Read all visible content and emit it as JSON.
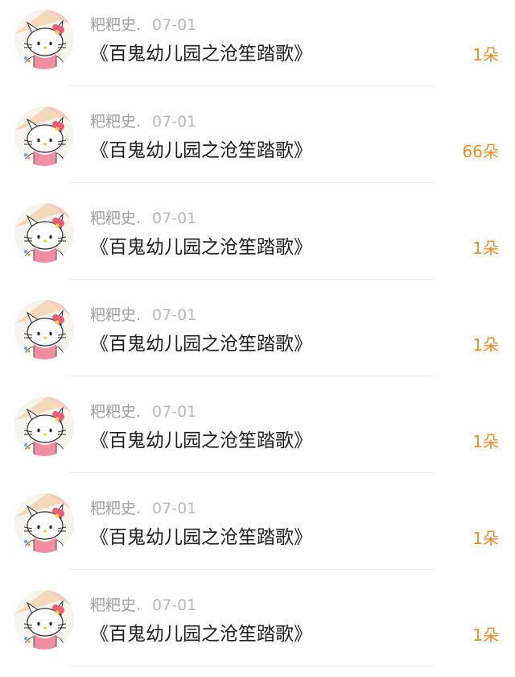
{
  "colors": {
    "count_accent": "#f08a2a",
    "meta_text": "#a0a0a0",
    "title_text": "#1f1f1f",
    "divider": "#efefef"
  },
  "avatar_icon": "hello-kitty-avatar",
  "items": [
    {
      "name": "粑粑史.",
      "date": "07-01",
      "title": "《百鬼幼儿园之沧笙踏歌》",
      "count": "1朵"
    },
    {
      "name": "粑粑史.",
      "date": "07-01",
      "title": "《百鬼幼儿园之沧笙踏歌》",
      "count": "66朵"
    },
    {
      "name": "粑粑史.",
      "date": "07-01",
      "title": "《百鬼幼儿园之沧笙踏歌》",
      "count": "1朵"
    },
    {
      "name": "粑粑史.",
      "date": "07-01",
      "title": "《百鬼幼儿园之沧笙踏歌》",
      "count": "1朵"
    },
    {
      "name": "粑粑史.",
      "date": "07-01",
      "title": "《百鬼幼儿园之沧笙踏歌》",
      "count": "1朵"
    },
    {
      "name": "粑粑史.",
      "date": "07-01",
      "title": "《百鬼幼儿园之沧笙踏歌》",
      "count": "1朵"
    },
    {
      "name": "粑粑史.",
      "date": "07-01",
      "title": "《百鬼幼儿园之沧笙踏歌》",
      "count": "1朵"
    }
  ]
}
